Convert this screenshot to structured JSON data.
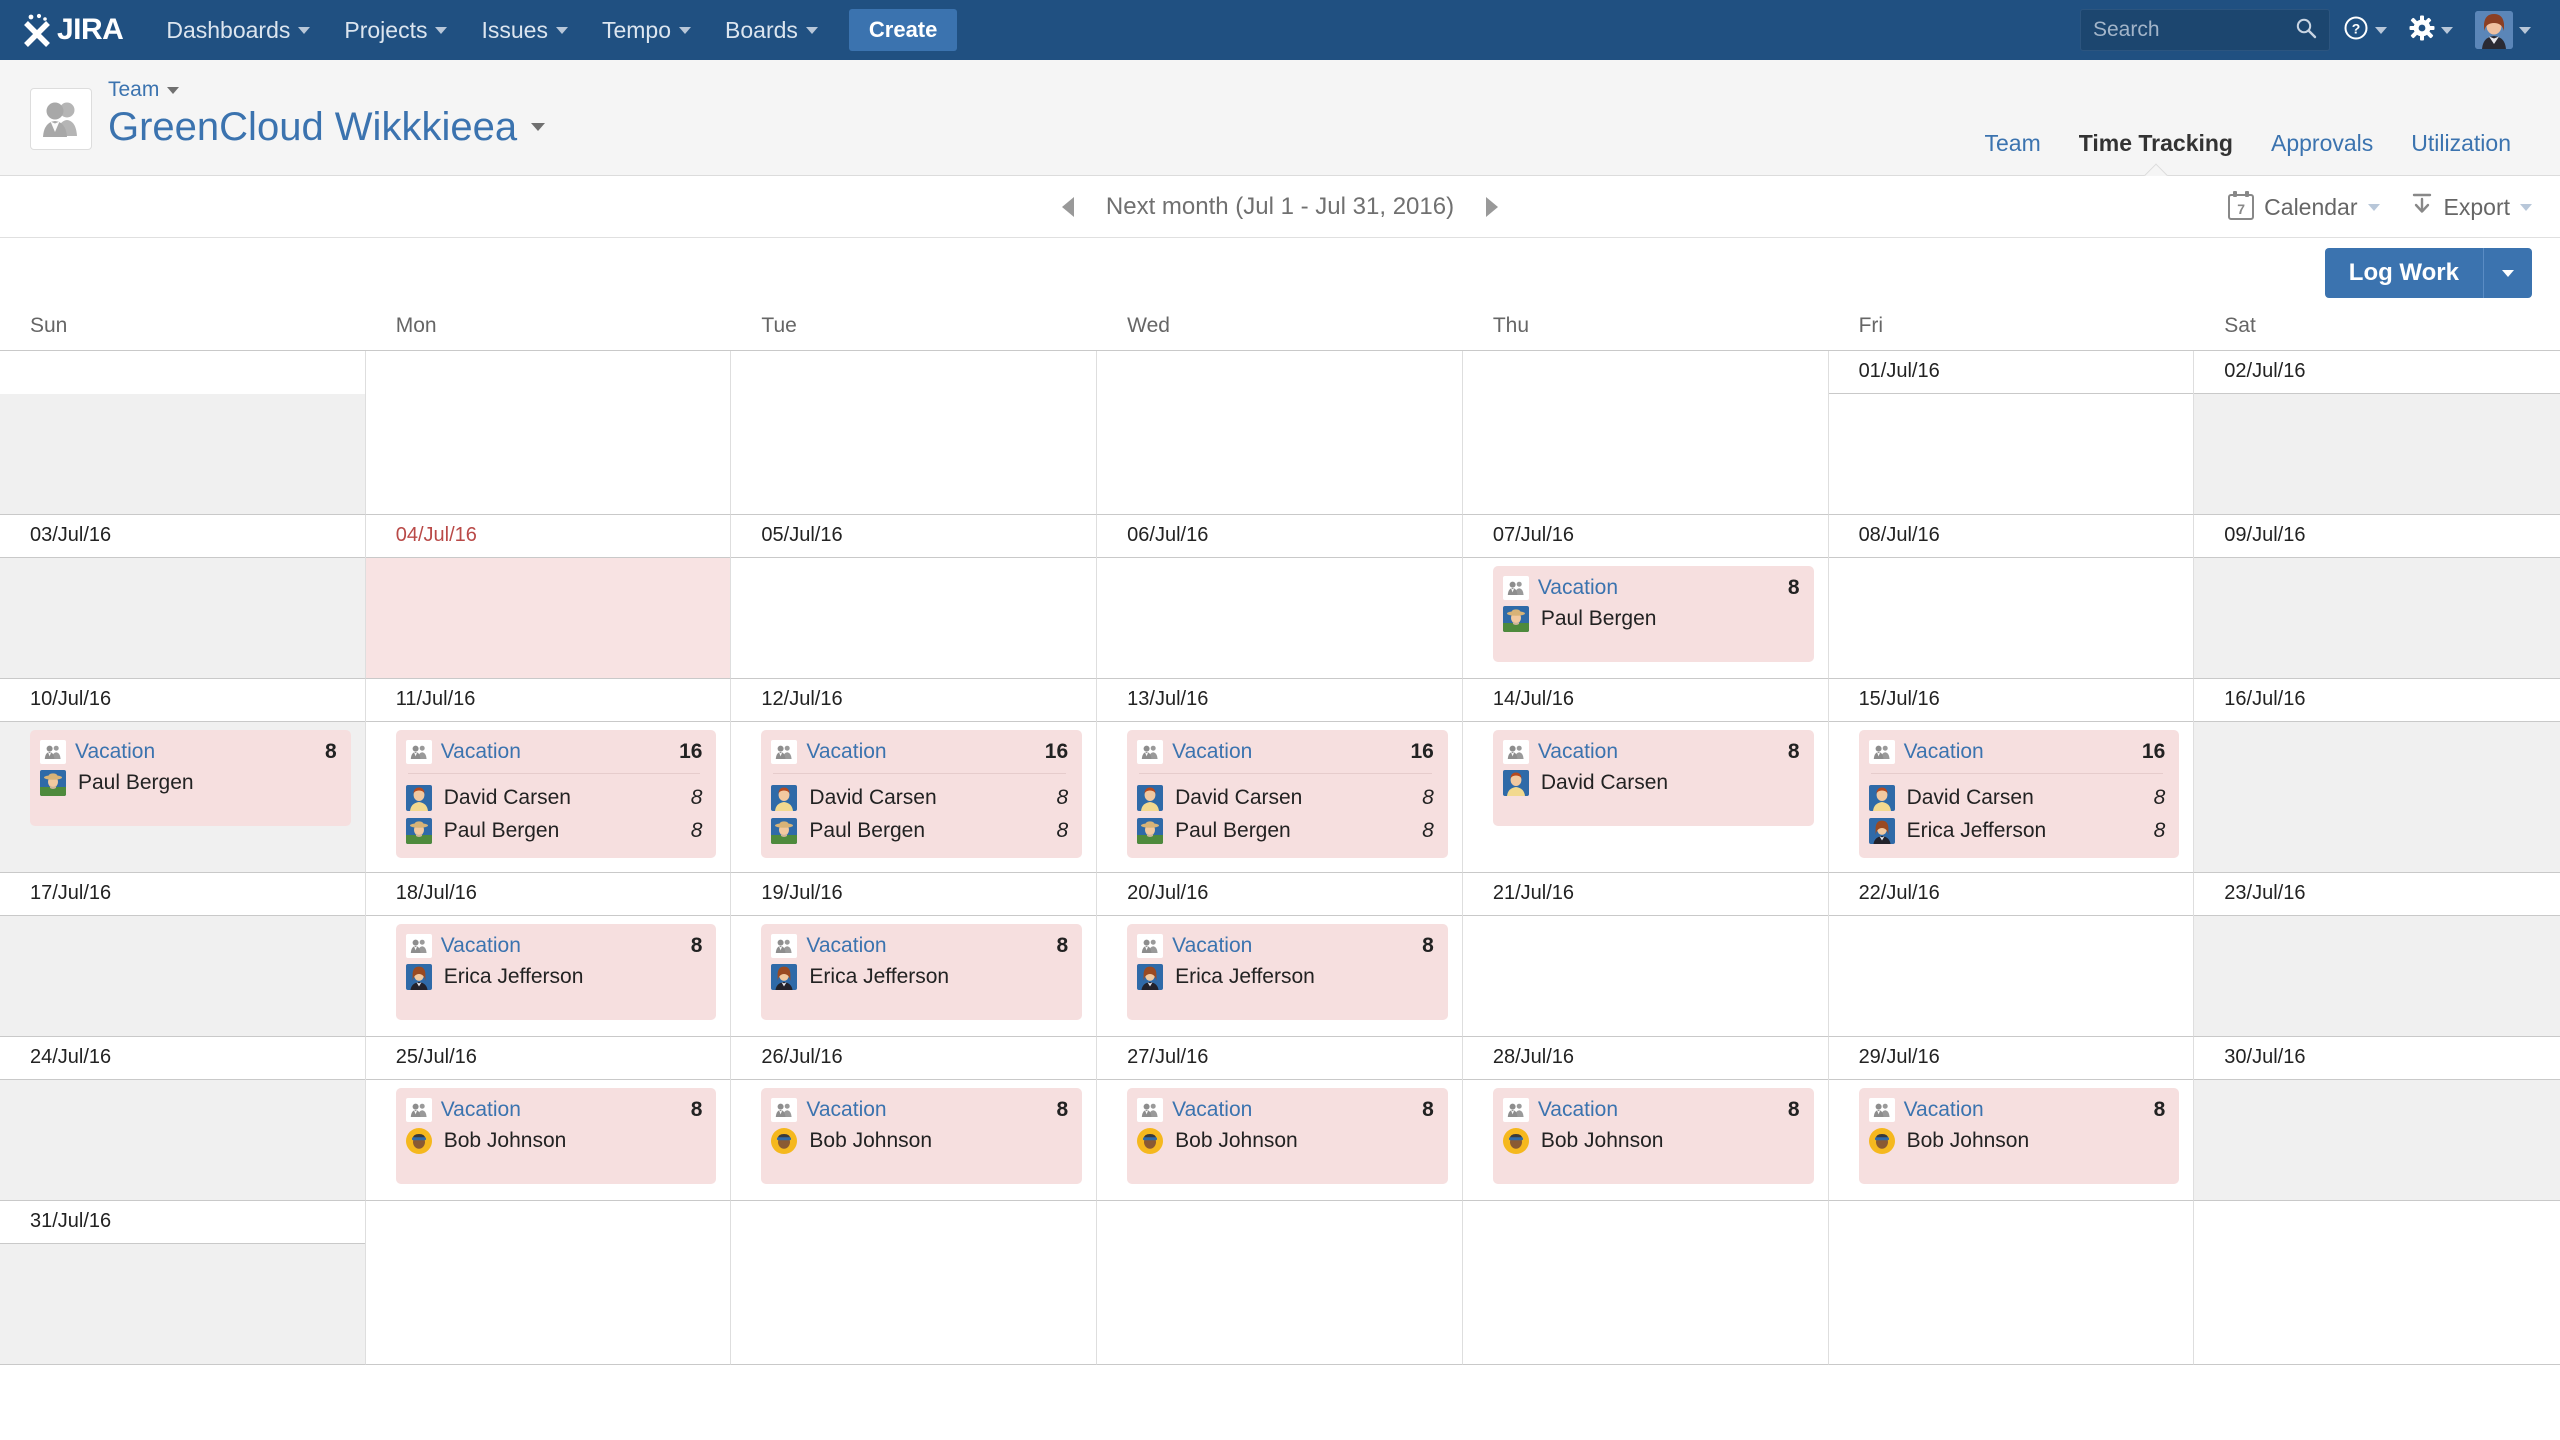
{
  "topnav": {
    "logo_text": "JIRA",
    "items": [
      {
        "label": "Dashboards",
        "has_caret": true
      },
      {
        "label": "Projects",
        "has_caret": true
      },
      {
        "label": "Issues",
        "has_caret": true
      },
      {
        "label": "Tempo",
        "has_caret": true
      },
      {
        "label": "Boards",
        "has_caret": true
      }
    ],
    "create_label": "Create",
    "search_placeholder": "Search",
    "search_value": "",
    "icons": [
      "search-icon",
      "help-icon",
      "settings-gear-icon",
      "user-avatar"
    ]
  },
  "header": {
    "breadcrumb": "Team",
    "title": "GreenCloud Wikkkieea",
    "tabs": [
      {
        "label": "Team",
        "active": false
      },
      {
        "label": "Time Tracking",
        "active": true
      },
      {
        "label": "Approvals",
        "active": false
      },
      {
        "label": "Utilization",
        "active": false
      }
    ]
  },
  "toolbar": {
    "period_label": "Next month (Jul 1 - Jul 31, 2016)",
    "calendar_label": "Calendar",
    "calendar_icon_day": "7",
    "export_label": "Export",
    "log_work_label": "Log Work"
  },
  "calendar": {
    "day_headers": [
      "Sun",
      "Mon",
      "Tue",
      "Wed",
      "Thu",
      "Fri",
      "Sat"
    ],
    "weeks": [
      [
        {
          "date": "",
          "empty": true,
          "weekend": true,
          "entries": []
        },
        {
          "date": "",
          "empty": true,
          "entries": []
        },
        {
          "date": "",
          "empty": true,
          "entries": []
        },
        {
          "date": "",
          "empty": true,
          "entries": []
        },
        {
          "date": "",
          "empty": true,
          "entries": []
        },
        {
          "date": "01/Jul/16",
          "entries": []
        },
        {
          "date": "02/Jul/16",
          "weekend": true,
          "entries": []
        }
      ],
      [
        {
          "date": "03/Jul/16",
          "weekend": true,
          "entries": []
        },
        {
          "date": "04/Jul/16",
          "holiday": true,
          "entries": []
        },
        {
          "date": "05/Jul/16",
          "entries": []
        },
        {
          "date": "06/Jul/16",
          "entries": []
        },
        {
          "date": "07/Jul/16",
          "entries": [
            {
              "title": "Vacation",
              "hours": "8",
              "people": [
                {
                  "name": "Paul Bergen",
                  "hours": "",
                  "avatar": "paul"
                }
              ]
            }
          ]
        },
        {
          "date": "08/Jul/16",
          "entries": []
        },
        {
          "date": "09/Jul/16",
          "weekend": true,
          "entries": []
        }
      ],
      [
        {
          "date": "10/Jul/16",
          "weekend": true,
          "entries": [
            {
              "title": "Vacation",
              "hours": "8",
              "people": [
                {
                  "name": "Paul Bergen",
                  "hours": "",
                  "avatar": "paul"
                }
              ]
            }
          ]
        },
        {
          "date": "11/Jul/16",
          "entries": [
            {
              "title": "Vacation",
              "hours": "16",
              "people": [
                {
                  "name": "David Carsen",
                  "hours": "8",
                  "avatar": "david"
                },
                {
                  "name": "Paul Bergen",
                  "hours": "8",
                  "avatar": "paul"
                }
              ]
            }
          ]
        },
        {
          "date": "12/Jul/16",
          "entries": [
            {
              "title": "Vacation",
              "hours": "16",
              "people": [
                {
                  "name": "David Carsen",
                  "hours": "8",
                  "avatar": "david"
                },
                {
                  "name": "Paul Bergen",
                  "hours": "8",
                  "avatar": "paul"
                }
              ]
            }
          ]
        },
        {
          "date": "13/Jul/16",
          "entries": [
            {
              "title": "Vacation",
              "hours": "16",
              "people": [
                {
                  "name": "David Carsen",
                  "hours": "8",
                  "avatar": "david"
                },
                {
                  "name": "Paul Bergen",
                  "hours": "8",
                  "avatar": "paul"
                }
              ]
            }
          ]
        },
        {
          "date": "14/Jul/16",
          "entries": [
            {
              "title": "Vacation",
              "hours": "8",
              "people": [
                {
                  "name": "David Carsen",
                  "hours": "",
                  "avatar": "david"
                }
              ]
            }
          ]
        },
        {
          "date": "15/Jul/16",
          "entries": [
            {
              "title": "Vacation",
              "hours": "16",
              "people": [
                {
                  "name": "David Carsen",
                  "hours": "8",
                  "avatar": "david"
                },
                {
                  "name": "Erica Jefferson",
                  "hours": "8",
                  "avatar": "erica"
                }
              ]
            }
          ]
        },
        {
          "date": "16/Jul/16",
          "weekend": true,
          "entries": []
        }
      ],
      [
        {
          "date": "17/Jul/16",
          "weekend": true,
          "entries": []
        },
        {
          "date": "18/Jul/16",
          "entries": [
            {
              "title": "Vacation",
              "hours": "8",
              "people": [
                {
                  "name": "Erica Jefferson",
                  "hours": "",
                  "avatar": "erica"
                }
              ]
            }
          ]
        },
        {
          "date": "19/Jul/16",
          "entries": [
            {
              "title": "Vacation",
              "hours": "8",
              "people": [
                {
                  "name": "Erica Jefferson",
                  "hours": "",
                  "avatar": "erica"
                }
              ]
            }
          ]
        },
        {
          "date": "20/Jul/16",
          "entries": [
            {
              "title": "Vacation",
              "hours": "8",
              "people": [
                {
                  "name": "Erica Jefferson",
                  "hours": "",
                  "avatar": "erica"
                }
              ]
            }
          ]
        },
        {
          "date": "21/Jul/16",
          "entries": []
        },
        {
          "date": "22/Jul/16",
          "entries": []
        },
        {
          "date": "23/Jul/16",
          "weekend": true,
          "entries": []
        }
      ],
      [
        {
          "date": "24/Jul/16",
          "weekend": true,
          "entries": []
        },
        {
          "date": "25/Jul/16",
          "entries": [
            {
              "title": "Vacation",
              "hours": "8",
              "people": [
                {
                  "name": "Bob Johnson",
                  "hours": "",
                  "avatar": "bob"
                }
              ]
            }
          ]
        },
        {
          "date": "26/Jul/16",
          "entries": [
            {
              "title": "Vacation",
              "hours": "8",
              "people": [
                {
                  "name": "Bob Johnson",
                  "hours": "",
                  "avatar": "bob"
                }
              ]
            }
          ]
        },
        {
          "date": "27/Jul/16",
          "entries": [
            {
              "title": "Vacation",
              "hours": "8",
              "people": [
                {
                  "name": "Bob Johnson",
                  "hours": "",
                  "avatar": "bob"
                }
              ]
            }
          ]
        },
        {
          "date": "28/Jul/16",
          "entries": [
            {
              "title": "Vacation",
              "hours": "8",
              "people": [
                {
                  "name": "Bob Johnson",
                  "hours": "",
                  "avatar": "bob"
                }
              ]
            }
          ]
        },
        {
          "date": "29/Jul/16",
          "entries": [
            {
              "title": "Vacation",
              "hours": "8",
              "people": [
                {
                  "name": "Bob Johnson",
                  "hours": "",
                  "avatar": "bob"
                }
              ]
            }
          ]
        },
        {
          "date": "30/Jul/16",
          "weekend": true,
          "entries": []
        }
      ],
      [
        {
          "date": "31/Jul/16",
          "weekend": true,
          "entries": []
        },
        {
          "date": "",
          "empty": true,
          "entries": []
        },
        {
          "date": "",
          "empty": true,
          "entries": []
        },
        {
          "date": "",
          "empty": true,
          "entries": []
        },
        {
          "date": "",
          "empty": true,
          "entries": []
        },
        {
          "date": "",
          "empty": true,
          "entries": []
        },
        {
          "date": "",
          "empty": true,
          "entries": []
        }
      ]
    ]
  },
  "colors": {
    "nav_blue": "#205081",
    "link_blue": "#3b73af",
    "vacation_pink": "#f6dfdf",
    "holiday_red": "#b94a48",
    "weekend_grey": "#f0f0f0"
  }
}
